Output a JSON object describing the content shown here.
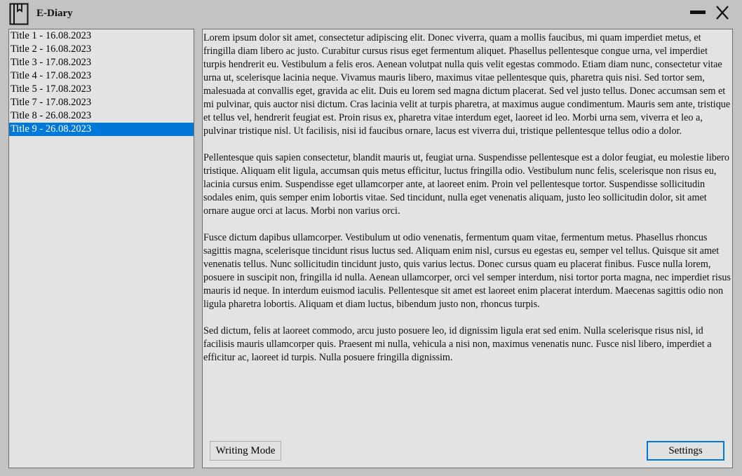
{
  "app": {
    "title": "E-Diary",
    "icon": "diary-book-icon",
    "window_controls": [
      "minimize-icon",
      "close-icon"
    ]
  },
  "colors": {
    "selection": "#0078d7",
    "background": "#c3c3c3",
    "panel": "#e3e3e3"
  },
  "entries": [
    {
      "label": "Title 1 - 16.08.2023"
    },
    {
      "label": "Title 2 - 16.08.2023"
    },
    {
      "label": "Title 3 - 17.08.2023"
    },
    {
      "label": "Title 4 - 17.08.2023"
    },
    {
      "label": "Title 5 - 17.08.2023"
    },
    {
      "label": "Title 7 - 17.08.2023"
    },
    {
      "label": "Title 8 - 26.08.2023"
    },
    {
      "label": "Title 9 - 26.08.2023",
      "selected": true
    }
  ],
  "content": {
    "paragraphs": [
      "Lorem ipsum dolor sit amet, consectetur adipiscing elit. Donec viverra, quam a mollis faucibus, mi quam imperdiet metus, et fringilla diam libero ac justo. Curabitur cursus risus eget fermentum aliquet. Phasellus pellentesque congue urna, vel imperdiet turpis hendrerit eu. Vestibulum a felis eros. Aenean volutpat nulla quis velit egestas commodo. Etiam diam nunc, consectetur vitae urna ut, scelerisque lacinia neque. Vivamus mauris libero, maximus vitae pellentesque quis, pharetra quis nisi. Sed tortor sem, malesuada at convallis eget, gravida ac elit. Duis eu lorem sed magna dictum placerat. Sed vel justo tellus. Donec accumsan sem et mi pulvinar, quis auctor nisi dictum. Cras lacinia velit at turpis pharetra, at maximus augue condimentum. Mauris sem ante, tristique et tellus vel, hendrerit feugiat est. Proin risus ex, pharetra vitae interdum eget, laoreet id leo. Morbi urna sem, viverra et leo a, pulvinar tristique nisl. Ut facilisis, nisi id faucibus ornare, lacus est viverra dui, tristique pellentesque tellus odio a dolor.",
      "Pellentesque quis sapien consectetur, blandit mauris ut, feugiat urna. Suspendisse pellentesque est a dolor feugiat, eu molestie libero tristique. Aliquam elit ligula, accumsan quis metus efficitur, luctus fringilla odio. Vestibulum nunc felis, scelerisque non risus eu, lacinia cursus enim. Suspendisse eget ullamcorper ante, at laoreet enim. Proin vel pellentesque tortor. Suspendisse sollicitudin sodales enim, quis semper enim lobortis vitae. Sed tincidunt, nulla eget venenatis aliquam, justo leo sollicitudin dolor, sit amet ornare augue orci at lacus. Morbi non varius orci.",
      "Fusce dictum dapibus ullamcorper. Vestibulum ut odio venenatis, fermentum quam vitae, fermentum metus. Phasellus rhoncus sagittis magna, scelerisque tincidunt risus luctus sed. Aliquam enim nisl, cursus eu egestas eu, semper vel tellus. Quisque sit amet venenatis tellus. Nunc sollicitudin tincidunt justo, quis varius lectus. Donec cursus quam eu placerat finibus. Fusce nulla lorem, posuere in suscipit non, fringilla id nulla. Aenean ullamcorper, orci vel semper interdum, nisi tortor porta magna, nec imperdiet risus mauris id neque. In interdum euismod iaculis. Pellentesque sit amet est laoreet enim placerat interdum. Maecenas sagittis odio non ligula pharetra lobortis. Aliquam et diam luctus, bibendum justo non, rhoncus turpis.",
      "Sed dictum, felis at laoreet commodo, arcu justo posuere leo, id dignissim ligula erat sed enim. Nulla scelerisque risus nisl, id facilisis mauris ullamcorper quis. Praesent mi nulla, vehicula a nisi non, maximus venenatis nunc. Fusce nisl libero, imperdiet a efficitur ac, laoreet id turpis. Nulla posuere fringilla dignissim."
    ]
  },
  "buttons": {
    "writing_mode": "Writing Mode",
    "settings": "Settings"
  }
}
